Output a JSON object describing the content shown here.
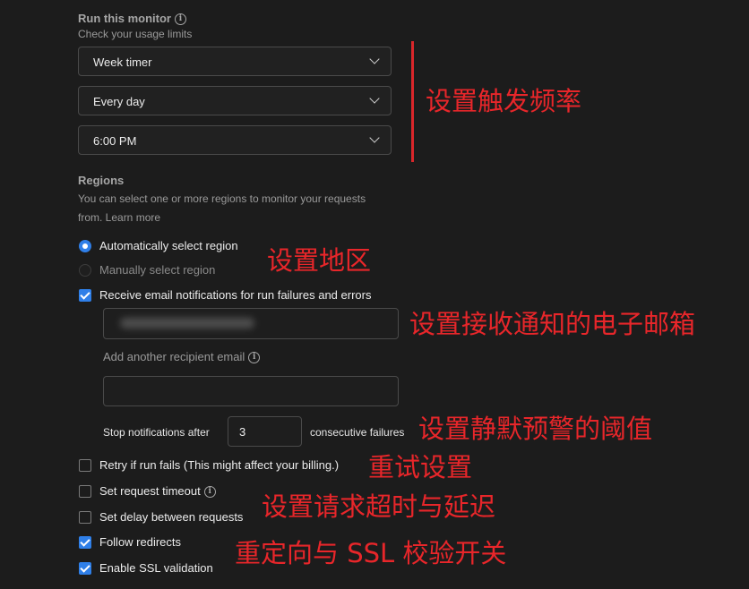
{
  "run_monitor": {
    "title": "Run this monitor",
    "info_icon": "i",
    "subtitle": "Check your usage limits",
    "frequency": "Week timer",
    "day": "Every day",
    "time": "6:00 PM"
  },
  "regions": {
    "title": "Regions",
    "desc_line1": "You can select one or more regions to monitor your requests",
    "desc_line2": "from. Learn more",
    "auto_label": "Automatically select region",
    "manual_label": "Manually select region",
    "auto_selected": true
  },
  "email": {
    "checkbox_label": "Receive email notifications for run failures and errors",
    "checked": true,
    "recipient_value": "",
    "add_label": "Add another recipient email",
    "add_value": ""
  },
  "stop_notifications": {
    "prefix": "Stop notifications after",
    "value": "3",
    "suffix": "consecutive failures"
  },
  "options": [
    {
      "label": "Retry if run fails (This might affect your billing.)",
      "checked": false
    },
    {
      "label": "Set request timeout",
      "checked": false
    },
    {
      "label": "Set delay between requests",
      "checked": false
    },
    {
      "label": "Follow redirects",
      "checked": true
    },
    {
      "label": "Enable SSL validation",
      "checked": true
    }
  ],
  "annotations": {
    "frequency": "设置触发频率",
    "region": "设置地区",
    "email": "设置接收通知的电子邮箱",
    "threshold": "设置静默预警的阈值",
    "retry": "重试设置",
    "timeout": "设置请求超时与延迟",
    "redirect_ssl": "重定向与 SSL 校验开关"
  },
  "colors": {
    "accent": "#2f7fe8",
    "annotation": "#e8262a",
    "background": "#1c1c1c"
  }
}
